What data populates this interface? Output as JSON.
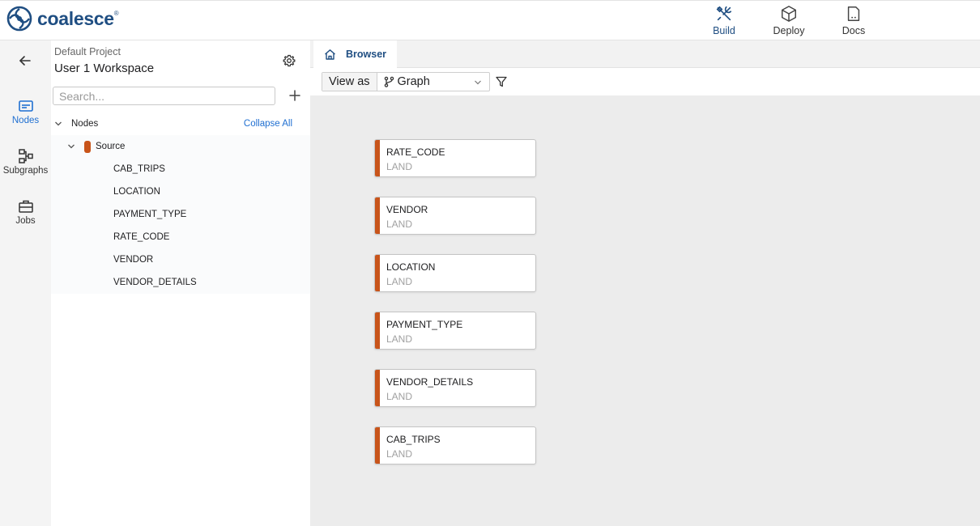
{
  "app": {
    "brand": "coalesce",
    "brand_mark": "®"
  },
  "topnav": [
    {
      "label": "Build",
      "icon": "build-tools-icon",
      "active": true
    },
    {
      "label": "Deploy",
      "icon": "deploy-box-icon",
      "active": false
    },
    {
      "label": "Docs",
      "icon": "docs-icon",
      "active": false
    }
  ],
  "rail": [
    {
      "label": "Nodes",
      "icon": "nodes-icon",
      "active": true
    },
    {
      "label": "Subgraphs",
      "icon": "subgraphs-icon",
      "active": false
    },
    {
      "label": "Jobs",
      "icon": "jobs-briefcase-icon",
      "active": false
    }
  ],
  "panel": {
    "project": "Default Project",
    "workspace": "User 1 Workspace",
    "search_placeholder": "Search...",
    "root_label": "Nodes",
    "collapse_all": "Collapse All",
    "group_label": "Source",
    "items": [
      "CAB_TRIPS",
      "LOCATION",
      "PAYMENT_TYPE",
      "RATE_CODE",
      "VENDOR",
      "VENDOR_DETAILS"
    ]
  },
  "tabs": [
    {
      "label": "Browser",
      "icon": "home-icon"
    }
  ],
  "toolbar": {
    "view_as": "View as",
    "view_mode": "Graph"
  },
  "graph": {
    "nodes": [
      {
        "name": "RATE_CODE",
        "type": "LAND"
      },
      {
        "name": "VENDOR",
        "type": "LAND"
      },
      {
        "name": "LOCATION",
        "type": "LAND"
      },
      {
        "name": "PAYMENT_TYPE",
        "type": "LAND"
      },
      {
        "name": "VENDOR_DETAILS",
        "type": "LAND"
      },
      {
        "name": "CAB_TRIPS",
        "type": "LAND"
      }
    ]
  },
  "colors": {
    "brand": "#1f4e82",
    "accent": "#1f6fd1",
    "source_node": "#c8541a"
  }
}
